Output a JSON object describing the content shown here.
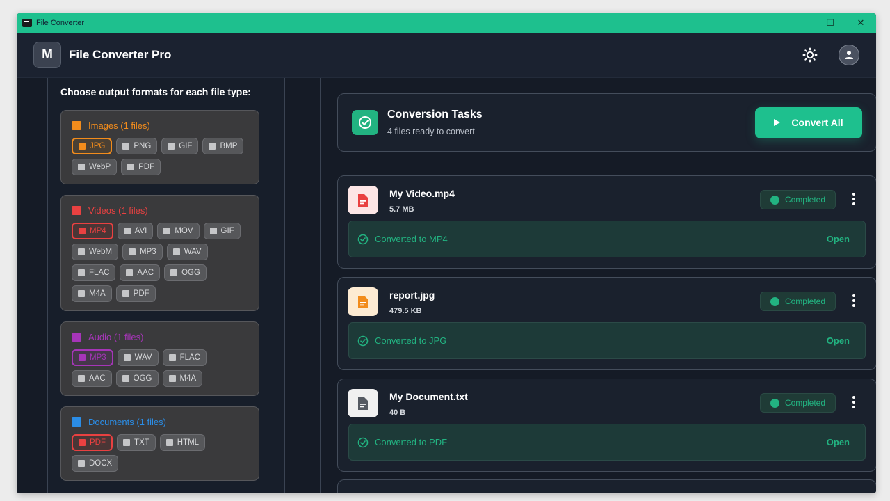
{
  "window": {
    "title": "File Converter",
    "controls": [
      "—",
      "☐",
      "✕"
    ]
  },
  "header": {
    "app_name": "File Converter Pro",
    "logo_letter": "M",
    "theme_icon": "sun-icon",
    "user_icon": "user-icon"
  },
  "sidebar": {
    "heading": "Choose output formats for each file type:",
    "groups": [
      {
        "title": "Images (1 files)",
        "color": "#f28c1c",
        "formats": [
          "JPG",
          "PNG",
          "GIF",
          "BMP",
          "WebP",
          "PDF"
        ],
        "selected": "JPG"
      },
      {
        "title": "Videos (1 files)",
        "color": "#e94141",
        "formats": [
          "MP4",
          "AVI",
          "MOV",
          "GIF",
          "WebM",
          "MP3",
          "WAV",
          "FLAC",
          "AAC",
          "OGG",
          "M4A",
          "PDF"
        ],
        "selected": "MP4"
      },
      {
        "title": "Audio (1 files)",
        "color": "#a635b8",
        "formats": [
          "MP3",
          "WAV",
          "FLAC",
          "AAC",
          "OGG",
          "M4A"
        ],
        "selected": "MP3"
      },
      {
        "title": "Documents (1 files)",
        "color": "#2b8de6",
        "formats": [
          "PDF",
          "TXT",
          "HTML",
          "DOCX"
        ],
        "selected": "PDF"
      }
    ]
  },
  "tasks": {
    "title": "Conversion Tasks",
    "subtitle": "4 files ready to convert",
    "convert_all_label": "Convert All"
  },
  "files": [
    {
      "name": "My Video.mp4",
      "size": "5.7 MB",
      "status": "Completed",
      "result": "Converted to MP4",
      "action": "Open",
      "icon_bg": "#fde6e6",
      "icon_color": "#e94141",
      "icon": "video-file-icon"
    },
    {
      "name": "report.jpg",
      "size": "479.5 KB",
      "status": "Completed",
      "result": "Converted to JPG",
      "action": "Open",
      "icon_bg": "#fdebd2",
      "icon_color": "#f28c1c",
      "icon": "image-file-icon"
    },
    {
      "name": "My Document.txt",
      "size": "40 B",
      "status": "Completed",
      "result": "Converted to PDF",
      "action": "Open",
      "icon_bg": "#f0f0f0",
      "icon_color": "#555a62",
      "icon": "document-file-icon"
    }
  ]
}
